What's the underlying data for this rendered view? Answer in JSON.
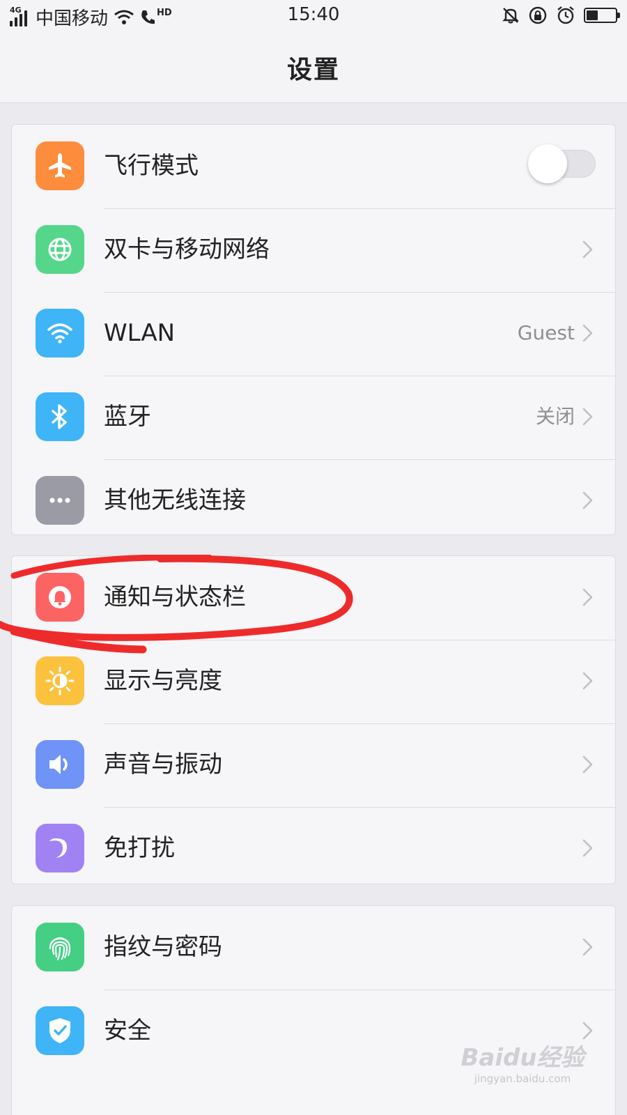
{
  "status_bar": {
    "network": "4G",
    "carrier": "中国移动",
    "hd": "HD",
    "time": "15:40",
    "battery_level": 0.4
  },
  "header": {
    "title": "设置"
  },
  "groups": [
    {
      "items": [
        {
          "label": "飞行模式",
          "icon": "airplane-icon",
          "color": "#fd8c3c",
          "toggle": true,
          "toggle_on": false
        },
        {
          "label": "双卡与移动网络",
          "icon": "globe-icon",
          "color": "#55d68b"
        },
        {
          "label": "WLAN",
          "icon": "wifi-icon",
          "color": "#3fb4f6",
          "value": "Guest"
        },
        {
          "label": "蓝牙",
          "icon": "bluetooth-icon",
          "color": "#3fb4f6",
          "value": "关闭"
        },
        {
          "label": "其他无线连接",
          "icon": "more-dots-icon",
          "color": "#9a9ba4"
        }
      ]
    },
    {
      "items": [
        {
          "label": "通知与状态栏",
          "icon": "bell-icon",
          "color": "#fc6464"
        },
        {
          "label": "显示与亮度",
          "icon": "brightness-icon",
          "color": "#fcc23d"
        },
        {
          "label": "声音与振动",
          "icon": "speaker-icon",
          "color": "#6f93f6"
        },
        {
          "label": "免打扰",
          "icon": "moon-icon",
          "color": "#a182f2"
        }
      ]
    },
    {
      "items": [
        {
          "label": "指纹与密码",
          "icon": "fingerprint-icon",
          "color": "#44cf84"
        },
        {
          "label": "安全",
          "icon": "shield-icon",
          "color": "#3fb4f6"
        }
      ]
    }
  ],
  "annotation": {
    "color": "#ee2b2b"
  },
  "watermark": {
    "logo": "Baidu经验",
    "url": "jingyan.baidu.com"
  }
}
